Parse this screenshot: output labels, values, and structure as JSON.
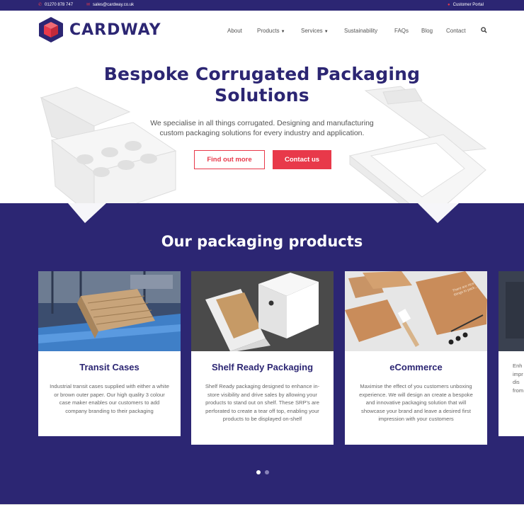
{
  "topbar": {
    "phone": "01270 878 747",
    "email": "sales@cardway.co.uk",
    "portal": "Customer Portal"
  },
  "header": {
    "logo_text": "CARDWAY",
    "nav": [
      {
        "label": "About"
      },
      {
        "label": "Products"
      },
      {
        "label": "Services"
      },
      {
        "label": "Sustainability"
      },
      {
        "label": "FAQs"
      },
      {
        "label": "Blog"
      },
      {
        "label": "Contact"
      }
    ]
  },
  "hero": {
    "title_line1": "Bespoke Corrugated Packaging",
    "title_line2": "Solutions",
    "subtitle": "We specialise in all things corrugated. Designing and manufacturing custom packaging solutions for every industry and application.",
    "btn_find": "Find out more",
    "btn_contact": "Contact us"
  },
  "products": {
    "title": "Our packaging products",
    "cards": [
      {
        "title": "Transit Cases",
        "desc": "Industrial transit cases supplied with either a white or brown outer paper. Our high quality 3 colour case maker enables our customers to add company branding to their packaging"
      },
      {
        "title": "Shelf Ready Packaging",
        "desc": "Shelf Ready packaging designed to enhance in-store visibility and drive sales by allowing your products to stand out on shelf. These SRP's are perforated to create a tear off top, enabling your products to be displayed on-shelf"
      },
      {
        "title": "eCommerce",
        "desc": "Maximise the effect of you customers unboxing experience. We will design an create a bespoke and innovative packaging solution that will showcase your brand and leave a desired first impression with your customers"
      },
      {
        "title": "",
        "desc": "Enh impr dis from"
      }
    ],
    "slide_text": "There are nice things to pack..."
  },
  "colors": {
    "brand": "#2c2673",
    "accent": "#e8394a"
  }
}
